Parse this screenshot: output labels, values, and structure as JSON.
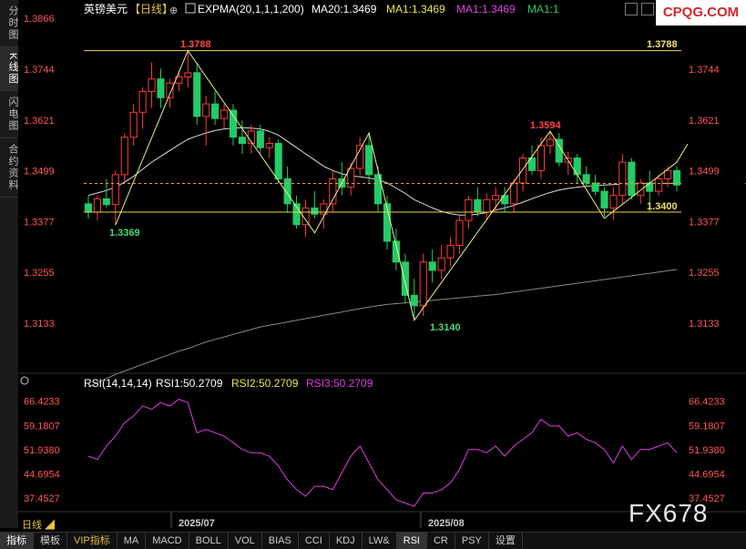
{
  "sidebar": {
    "items": [
      "分时图",
      "K线图",
      "闪电图",
      "合约资料"
    ]
  },
  "header": {
    "symbol": "英镑美元",
    "period_tag": "【日线】",
    "indicator": "EXPMA(20,1,1,1,200)",
    "ma20": "MA20:1.3469",
    "ma1a": "MA1:1.3469",
    "ma1b": "MA1:1.3469",
    "ma1c": "MA1:1"
  },
  "rsi_header": {
    "name": "RSI(14,14,14)",
    "rsi1": "RSI1:50.2709",
    "rsi2": "RSI2:50.2709",
    "rsi3": "RSI3:50.2709"
  },
  "logo_text": "CPQG.COM",
  "watermark_text": "FX678",
  "period_label": "日线 ◢",
  "toolbar": {
    "items": [
      "指标",
      "模板",
      "VIP指标",
      "MA",
      "MACD",
      "BOLL",
      "VOL",
      "BIAS",
      "CCI",
      "KDJ",
      "LW&",
      "RSI",
      "CR",
      "PSY",
      "设置"
    ]
  },
  "colors": {
    "up": "#ff3b3b",
    "down": "#22cc66",
    "ma": "#dddddd",
    "ma200": "#888888",
    "rsi": "#e040e0",
    "hline": "#e8d44a",
    "zigzag": "#eeee88",
    "current": "#ff9a2a"
  },
  "chart_data": {
    "type": "candlestick",
    "price_ticks": [
      1.3866,
      1.3744,
      1.3621,
      1.3499,
      1.3377,
      1.3255,
      1.3133
    ],
    "price_ylim": [
      1.3866,
      1.3133
    ],
    "x_labels": [
      "2025/07",
      "2025/08"
    ],
    "current_price": 1.3469,
    "horizontal_lines": [
      1.3788,
      1.34
    ],
    "annotations": [
      {
        "text": "1.3788",
        "value": 1.3788,
        "color": "#ff4444"
      },
      {
        "text": "1.3369",
        "value": 1.3369,
        "color": "#44dd77"
      },
      {
        "text": "1.3594",
        "value": 1.3594,
        "color": "#ff4444"
      },
      {
        "text": "1.3140",
        "value": 1.314,
        "color": "#44dd77"
      },
      {
        "text": "1.3788",
        "value": 1.3788,
        "color": "#f0e070"
      },
      {
        "text": "1.3400",
        "value": 1.34,
        "color": "#f0e070"
      }
    ],
    "candles": [
      [
        1.342,
        1.344,
        1.3385,
        1.34
      ],
      [
        1.34,
        1.344,
        1.338,
        1.3432
      ],
      [
        1.3432,
        1.348,
        1.341,
        1.3418
      ],
      [
        1.3418,
        1.35,
        1.3369,
        1.349
      ],
      [
        1.349,
        1.359,
        1.3475,
        1.358
      ],
      [
        1.358,
        1.366,
        1.356,
        1.364
      ],
      [
        1.364,
        1.37,
        1.36,
        1.369
      ],
      [
        1.369,
        1.376,
        1.365,
        1.372
      ],
      [
        1.372,
        1.3745,
        1.365,
        1.3675
      ],
      [
        1.3675,
        1.372,
        1.365,
        1.371
      ],
      [
        1.371,
        1.374,
        1.369,
        1.3725
      ],
      [
        1.3725,
        1.3788,
        1.37,
        1.3735
      ],
      [
        1.3735,
        1.376,
        1.361,
        1.363
      ],
      [
        1.363,
        1.368,
        1.356,
        1.366
      ],
      [
        1.366,
        1.369,
        1.361,
        1.3625
      ],
      [
        1.3625,
        1.366,
        1.36,
        1.3645
      ],
      [
        1.3645,
        1.366,
        1.356,
        1.358
      ],
      [
        1.358,
        1.362,
        1.354,
        1.3565
      ],
      [
        1.3565,
        1.361,
        1.354,
        1.3595
      ],
      [
        1.3595,
        1.361,
        1.354,
        1.3555
      ],
      [
        1.3555,
        1.358,
        1.353,
        1.3565
      ],
      [
        1.3565,
        1.3575,
        1.347,
        1.348
      ],
      [
        1.348,
        1.351,
        1.34,
        1.342
      ],
      [
        1.342,
        1.344,
        1.336,
        1.337
      ],
      [
        1.337,
        1.343,
        1.334,
        1.341
      ],
      [
        1.341,
        1.345,
        1.3385,
        1.3395
      ],
      [
        1.3395,
        1.343,
        1.336,
        1.342
      ],
      [
        1.342,
        1.35,
        1.34,
        1.348
      ],
      [
        1.348,
        1.352,
        1.344,
        1.346
      ],
      [
        1.346,
        1.352,
        1.344,
        1.3505
      ],
      [
        1.3505,
        1.358,
        1.349,
        1.356
      ],
      [
        1.356,
        1.359,
        1.347,
        1.349
      ],
      [
        1.349,
        1.351,
        1.34,
        1.342
      ],
      [
        1.342,
        1.344,
        1.331,
        1.333
      ],
      [
        1.333,
        1.336,
        1.326,
        1.328
      ],
      [
        1.328,
        1.33,
        1.318,
        1.32
      ],
      [
        1.32,
        1.324,
        1.314,
        1.3175
      ],
      [
        1.3175,
        1.33,
        1.315,
        1.328
      ],
      [
        1.328,
        1.331,
        1.323,
        1.326
      ],
      [
        1.326,
        1.332,
        1.324,
        1.329
      ],
      [
        1.329,
        1.334,
        1.327,
        1.332
      ],
      [
        1.332,
        1.339,
        1.33,
        1.338
      ],
      [
        1.338,
        1.344,
        1.336,
        1.343
      ],
      [
        1.343,
        1.346,
        1.339,
        1.34
      ],
      [
        1.34,
        1.3445,
        1.338,
        1.343
      ],
      [
        1.343,
        1.346,
        1.34,
        1.344
      ],
      [
        1.344,
        1.346,
        1.34,
        1.342
      ],
      [
        1.342,
        1.348,
        1.34,
        1.347
      ],
      [
        1.347,
        1.354,
        1.345,
        1.353
      ],
      [
        1.353,
        1.356,
        1.349,
        1.35
      ],
      [
        1.35,
        1.358,
        1.348,
        1.356
      ],
      [
        1.356,
        1.3594,
        1.354,
        1.3575
      ],
      [
        1.3575,
        1.359,
        1.351,
        1.352
      ],
      [
        1.352,
        1.3545,
        1.349,
        1.353
      ],
      [
        1.353,
        1.354,
        1.347,
        1.349
      ],
      [
        1.349,
        1.351,
        1.346,
        1.347
      ],
      [
        1.347,
        1.349,
        1.344,
        1.345
      ],
      [
        1.345,
        1.346,
        1.339,
        1.341
      ],
      [
        1.341,
        1.346,
        1.338,
        1.344
      ],
      [
        1.344,
        1.354,
        1.342,
        1.352
      ],
      [
        1.352,
        1.353,
        1.343,
        1.344
      ],
      [
        1.344,
        1.348,
        1.342,
        1.347
      ],
      [
        1.347,
        1.35,
        1.34,
        1.345
      ],
      [
        1.345,
        1.349,
        1.344,
        1.348
      ],
      [
        1.348,
        1.351,
        1.346,
        1.35
      ],
      [
        1.35,
        1.351,
        1.345,
        1.3465
      ]
    ],
    "ma20": [
      1.344,
      1.3446,
      1.3452,
      1.346,
      1.3472,
      1.3486,
      1.3503,
      1.352,
      1.3534,
      1.3548,
      1.3562,
      1.3575,
      1.3583,
      1.359,
      1.3596,
      1.36,
      1.3602,
      1.3603,
      1.3602,
      1.36,
      1.3594,
      1.3585,
      1.357,
      1.3555,
      1.354,
      1.3525,
      1.351,
      1.35,
      1.3492,
      1.3487,
      1.3485,
      1.3482,
      1.3478,
      1.347,
      1.3458,
      1.3445,
      1.343,
      1.342,
      1.341,
      1.3402,
      1.3396,
      1.3393,
      1.3393,
      1.3395,
      1.3399,
      1.3405,
      1.341,
      1.3416,
      1.3424,
      1.3432,
      1.344,
      1.3447,
      1.3453,
      1.3457,
      1.346,
      1.3462,
      1.3464,
      1.3465,
      1.3466,
      1.3467,
      1.3468,
      1.3468,
      1.3469,
      1.3469,
      1.3469,
      1.3469
    ],
    "ma200": [
      1.298,
      1.299,
      1.3,
      1.301,
      1.3018,
      1.3026,
      1.3034,
      1.3042,
      1.305,
      1.3058,
      1.3066,
      1.3072,
      1.308,
      1.3088,
      1.3094,
      1.31,
      1.3106,
      1.3112,
      1.3118,
      1.3124,
      1.3128,
      1.3132,
      1.3136,
      1.314,
      1.3144,
      1.3148,
      1.3152,
      1.3156,
      1.316,
      1.3164,
      1.3168,
      1.3172,
      1.3175,
      1.3178,
      1.318,
      1.3182,
      1.3184,
      1.3186,
      1.3188,
      1.319,
      1.3192,
      1.3194,
      1.3196,
      1.3198,
      1.32,
      1.3202,
      1.3205,
      1.3208,
      1.3211,
      1.3214,
      1.3217,
      1.322,
      1.3223,
      1.3226,
      1.3229,
      1.3232,
      1.3235,
      1.3238,
      1.3241,
      1.3244,
      1.3247,
      1.325,
      1.3253,
      1.3256,
      1.3259,
      1.3262
    ],
    "zigzag": [
      [
        3,
        1.3369
      ],
      [
        11,
        1.3788
      ],
      [
        25,
        1.335
      ],
      [
        31,
        1.359
      ],
      [
        36,
        1.314
      ],
      [
        51,
        1.3594
      ],
      [
        57,
        1.3385
      ],
      [
        65,
        1.352
      ]
    ],
    "rsi_ticks": [
      66.4233,
      59.1807,
      51.938,
      44.6954,
      37.4527
    ],
    "rsi_ylim": [
      68.5,
      34.5
    ],
    "rsi": [
      50,
      49,
      53,
      56,
      60,
      62,
      65,
      64,
      66,
      65,
      67,
      66,
      57,
      58,
      57,
      56,
      54,
      52,
      51,
      51,
      50,
      47,
      43,
      40,
      38,
      41,
      41,
      40,
      45,
      50,
      53,
      48,
      43,
      40,
      37,
      36,
      35,
      39,
      39,
      40,
      42,
      46,
      52,
      52,
      51,
      53,
      50,
      53,
      55,
      57,
      61,
      59,
      59,
      56,
      57,
      55,
      54,
      52,
      48,
      53,
      49,
      52,
      52,
      53,
      54,
      51
    ]
  }
}
